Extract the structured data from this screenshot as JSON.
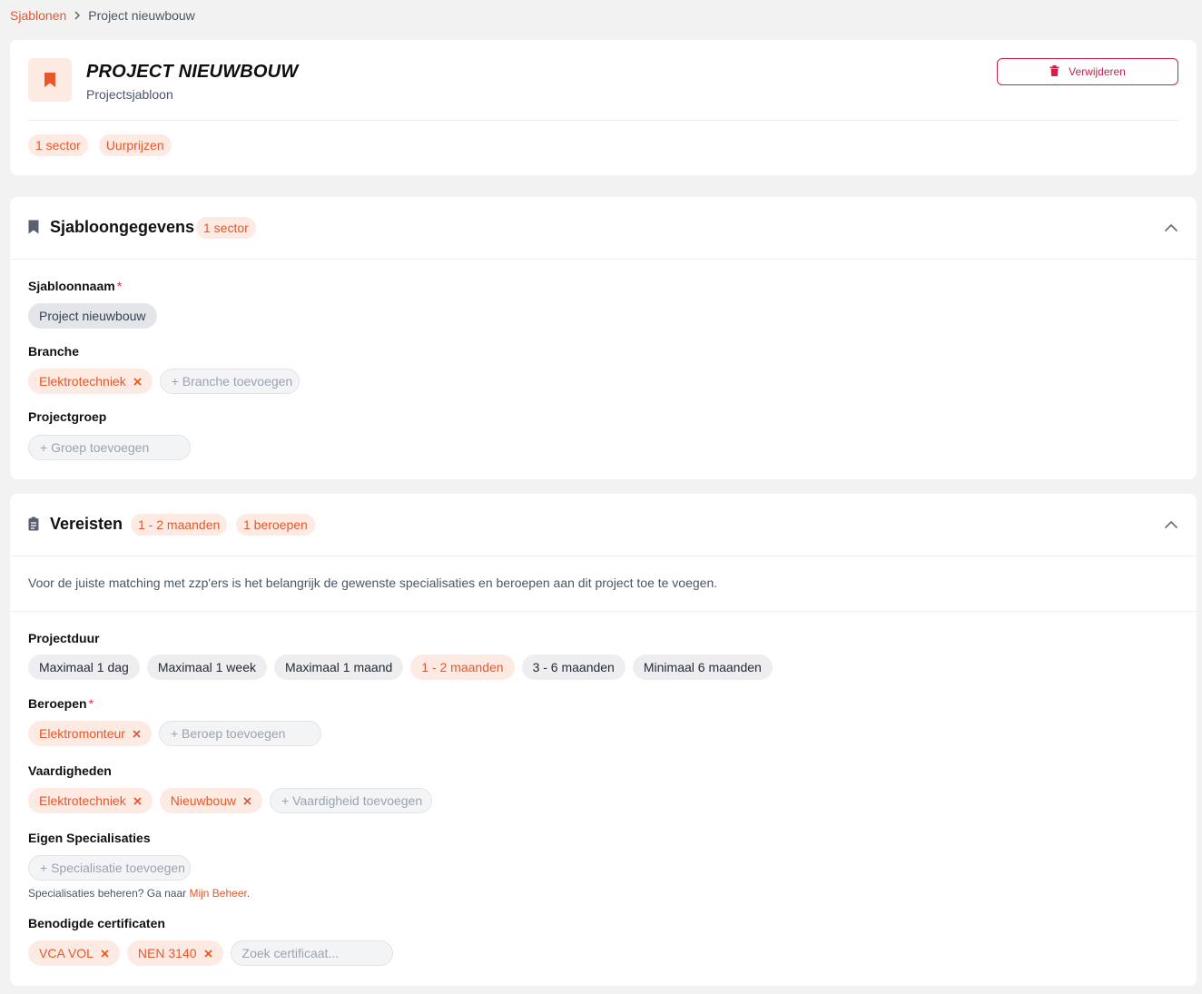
{
  "breadcrumb": {
    "parent": "Sjablonen",
    "current": "Project nieuwbouw"
  },
  "header": {
    "title": "PROJECT NIEUWBOUW",
    "subtitle": "Projectsjabloon",
    "delete_label": "Verwijderen",
    "tags": [
      "1 sector",
      "Uurprijzen"
    ]
  },
  "template_section": {
    "title": "Sjabloongegevens",
    "badge": "1 sector",
    "name_label": "Sjabloonnaam",
    "name_value": "Project nieuwbouw",
    "branch_label": "Branche",
    "branch_selected": "Elektrotechniek",
    "branch_add": "+ Branche toevoegen",
    "group_label": "Projectgroep",
    "group_add": "+ Groep toevoegen"
  },
  "requirements_section": {
    "title": "Vereisten",
    "badges": [
      "1 - 2 maanden",
      "1 beroepen"
    ],
    "description": "Voor de juiste matching met zzp'ers is het belangrijk de gewenste specialisaties en beroepen aan dit project toe te voegen.",
    "duration_label": "Projectduur",
    "duration_options": [
      "Maximaal 1 dag",
      "Maximaal 1 week",
      "Maximaal 1 maand",
      "1 - 2 maanden",
      "3 - 6 maanden",
      "Minimaal 6 maanden"
    ],
    "duration_selected": "1 - 2 maanden",
    "professions_label": "Beroepen",
    "professions_selected": [
      "Elektromonteur"
    ],
    "profession_add": "+ Beroep toevoegen",
    "skills_label": "Vaardigheden",
    "skills_selected": [
      "Elektrotechniek",
      "Nieuwbouw"
    ],
    "skill_add": "+ Vaardigheid toevoegen",
    "specializations_label": "Eigen Specialisaties",
    "specialization_add": "+ Specialisatie toevoegen",
    "specializations_hint": "Specialisaties beheren? Ga naar",
    "specializations_hint_link": "Mijn Beheer",
    "certificates_label": "Benodigde certificaten",
    "certificates_selected": [
      "VCA VOL",
      "NEN 3140"
    ],
    "certificate_search_placeholder": "Zoek certificaat..."
  },
  "colors": {
    "accent": "#e8562a",
    "accent_bg": "#fdeae3",
    "danger": "#d21e4a"
  },
  "icons": {
    "header": "bookmark-icon",
    "delete": "trash-icon",
    "template_section": "bookmark-icon",
    "requirements_section": "clipboard-icon",
    "collapse": "chevron-up-icon",
    "remove": "close-icon"
  }
}
